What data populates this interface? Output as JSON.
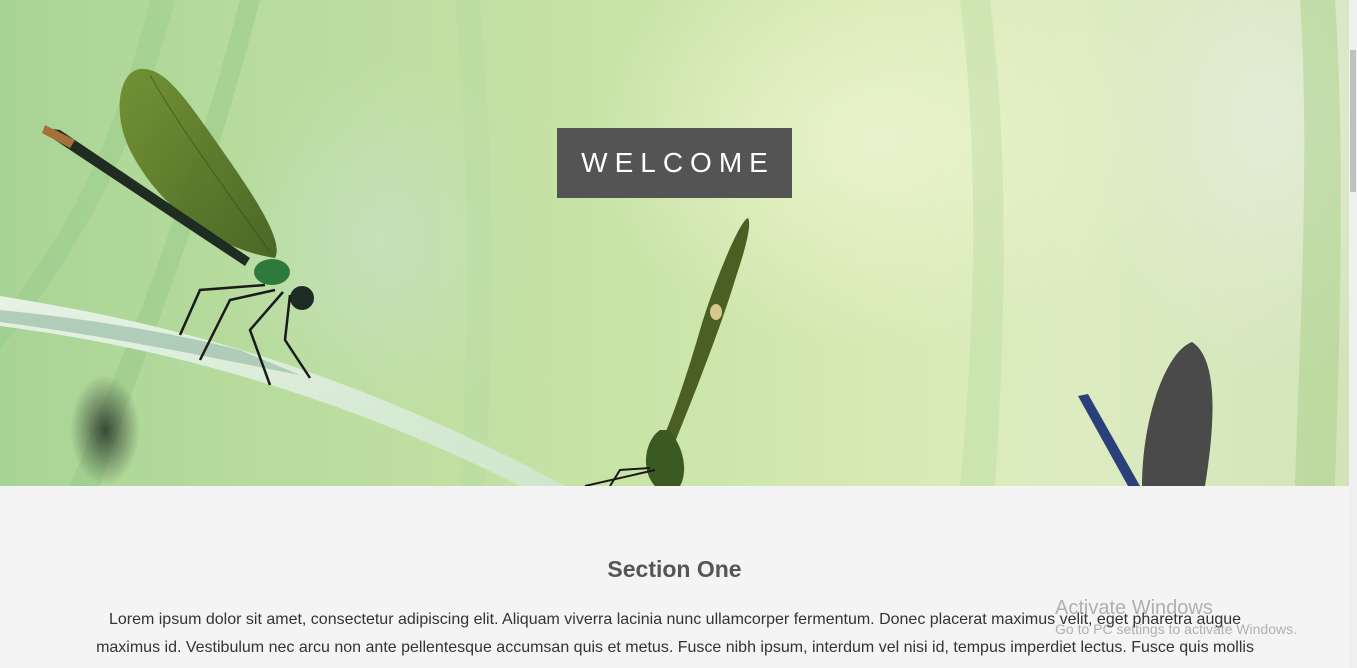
{
  "hero": {
    "welcome_label": "WELCOME"
  },
  "section_one": {
    "title": "Section One",
    "body": "Lorem ipsum dolor sit amet, consectetur adipiscing elit. Aliquam viverra lacinia nunc ullamcorper fermentum. Donec placerat maximus velit, eget pharetra augue maximus id. Vestibulum nec arcu non ante pellentesque accumsan quis et metus. Fusce nibh ipsum, interdum vel nisi id, tempus imperdiet lectus. Fusce quis mollis lorem. Quisque eleifend sem vitae malesuada. Phasellus ut ut odio porttitor auctor."
  },
  "watermark": {
    "title": "Activate Windows",
    "subtitle": "Go to PC settings to activate Windows."
  },
  "colors": {
    "welcome_bg": "#545454",
    "content_bg": "#f4f4f4",
    "title_text": "#555555"
  }
}
